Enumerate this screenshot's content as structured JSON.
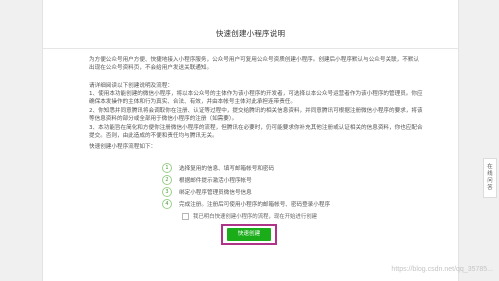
{
  "page": {
    "title": "快速创建小程序说明",
    "intro": "为方便公众号用户方便、快捷地接入小程序服务，公众号用户可复用公众号资质创建小程序。创建后小程序默认与公众号关联，不默认\n出现在公众号资料页，不会给用户发送关联通知。",
    "notes_heading": "请详细阅读以下创建说明及流程：",
    "notes": "1、使用本功能创建的微信小程序，将以本公众号的主体作为该小程序的开发者，可选择以本公众号运营者作为该小程序的管理员。你应\n确保本发操作的主体和行为真实、合法、有效，并由本帐号主体对此承担连带责任。\n2、你知悉并同意腾讯将会调取你在注册、认证等过程中，提交给腾讯的相关信息资料，并同意腾讯可根据注册微信小程序的要求，将该\n等信息资料的部分或全部用于微信小程序的注册（如需要）。\n3、本功能旨在简化和方便你注册微信小程序的流程，但腾讯在必要时，仍可能要求你补充其他注册或认证相关的信息资料，你也应配合\n提交。否则，由此造成的不便和责任均与腾讯无关。",
    "steps_label": "快速创建小程序流程如下：",
    "steps": [
      {
        "num": "1",
        "text": "选择复用的信息、填写邮箱帐号和密码"
      },
      {
        "num": "2",
        "text": "根据邮件提示激活小程序帐号"
      },
      {
        "num": "3",
        "text": "绑定小程序管理员微信号信息"
      },
      {
        "num": "4",
        "text": "完成注册。注册后可使用小程序的邮箱帐号、密码登录小程序"
      }
    ],
    "agree_text": "我已明白快速创建小程序的流程，现在开始进行创建",
    "create_button": "快速创建"
  },
  "side_widget": {
    "label": "在线问答"
  },
  "watermark": "https://blog.csdn.net/qq_35785...",
  "colors": {
    "accent": "#1aad19",
    "highlight_frame": "#b0338a"
  }
}
